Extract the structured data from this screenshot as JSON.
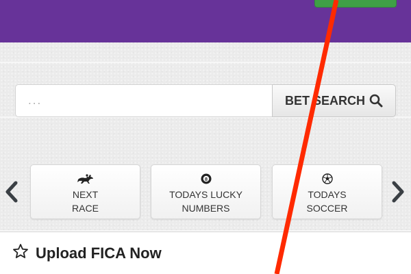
{
  "header": {
    "background_color": "#673399",
    "top_button_color": "#3fa046"
  },
  "search": {
    "placeholder": "...",
    "value": "",
    "button_label": "BET SEARCH",
    "button_icon": "search-icon"
  },
  "quick_links": {
    "prev_icon": "chevron-left-icon",
    "next_icon": "chevron-right-icon",
    "items": [
      {
        "icon": "horse-racing-icon",
        "line1": "NEXT",
        "line2": "RACE"
      },
      {
        "icon": "lucky-ball-icon",
        "ball_number": "8",
        "line1": "TODAYS LUCKY",
        "line2": "NUMBERS"
      },
      {
        "icon": "soccer-ball-icon",
        "line1": "TODAYS",
        "line2": "SOCCER"
      }
    ]
  },
  "panel": {
    "icon": "star-outline-icon",
    "title": "Upload FICA Now"
  },
  "overlay": {
    "annotation_line_color": "#ff2a00"
  }
}
